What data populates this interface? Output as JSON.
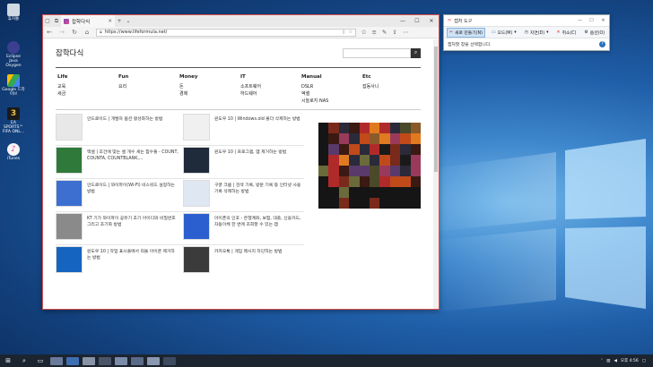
{
  "desktop": {
    "icons": [
      {
        "label": "휴지통",
        "color": "#cfd8e3"
      },
      {
        "label": "Eclipse Java Oxygen",
        "color": "#3b3f8f"
      },
      {
        "label": "Google 드라이브",
        "color": "#34a853"
      },
      {
        "label": "EA SPORTS™ FIFA ONL...",
        "color": "#1a1a1a"
      },
      {
        "label": "iTunes",
        "color": "#f5f5f5"
      }
    ]
  },
  "browser": {
    "tab_title": "잡학다식",
    "url": "https://www.lifeformula.net/",
    "window_controls": [
      "—",
      "☐",
      "✕"
    ]
  },
  "site": {
    "title": "잡학다식",
    "menu": [
      {
        "heading": "Life",
        "items": [
          "교육",
          "세금"
        ]
      },
      {
        "heading": "Fun",
        "items": [
          "요리"
        ]
      },
      {
        "heading": "Money",
        "items": [
          "돈",
          "경제"
        ]
      },
      {
        "heading": "IT",
        "items": [
          "소프트웨어",
          "하드웨어"
        ]
      },
      {
        "heading": "Manual",
        "items": [
          "DSLR",
          "엑셀",
          "시놀로지 NAS"
        ]
      },
      {
        "heading": "Etc",
        "items": [
          "잡동사니"
        ]
      }
    ],
    "posts": [
      {
        "title": "안드로이드 | 개발자 옵션 활성화하는 방법",
        "color": "#e8e8e8"
      },
      {
        "title": "윈도우 10 | Windows.old 폴더 삭제하는 방법",
        "color": "#f0f0f0"
      },
      {
        "title": "엑셀 | 조건에 맞는 셀 개수 세는 함수들 - COUNT, COUNTA, COUNTBLANK,...",
        "color": "#2f7a3b"
      },
      {
        "title": "윈도우 10 | 프로그램, 앱 제거하는 방법",
        "color": "#1f2b3a"
      },
      {
        "title": "안드로이드 | 와이파이(Wi-Fi) 비스워드 설정하는 방법",
        "color": "#3c6fd0"
      },
      {
        "title": "구글 크롬 | 검색 기록, 방문 기록 등 인터넷 사용 기록 삭제하는 방법",
        "color": "#dfe7f2"
      },
      {
        "title": "KT 기가 와이파이 공유기 초기 아이디와 비밀번호 그리고 초기화 방법",
        "color": "#8a8a8a"
      },
      {
        "title": "아이폰의 인포 - 은행계좌, 보험, 대출, 신용카드, 자동이체 한 번에 조회할 수 있는 앱",
        "color": "#2b5fd0"
      },
      {
        "title": "윈도우 10 | 작업 표시줄에서 띄울 아이콘 제거하는 방법",
        "color": "#1565c0"
      },
      {
        "title": "카카오톡 | 게임 메시지 차단하는 방법",
        "color": "#3b3b3b"
      }
    ]
  },
  "snipping_tool": {
    "title": "캡처 도구",
    "buttons": [
      "새로 만들기(N)",
      "모드(M)",
      "지연(D)",
      "취소(C)",
      "옵션(O)"
    ],
    "status": "캡처할 창을 선택합니다."
  },
  "taskbar": {
    "time": "오후 4:56"
  }
}
